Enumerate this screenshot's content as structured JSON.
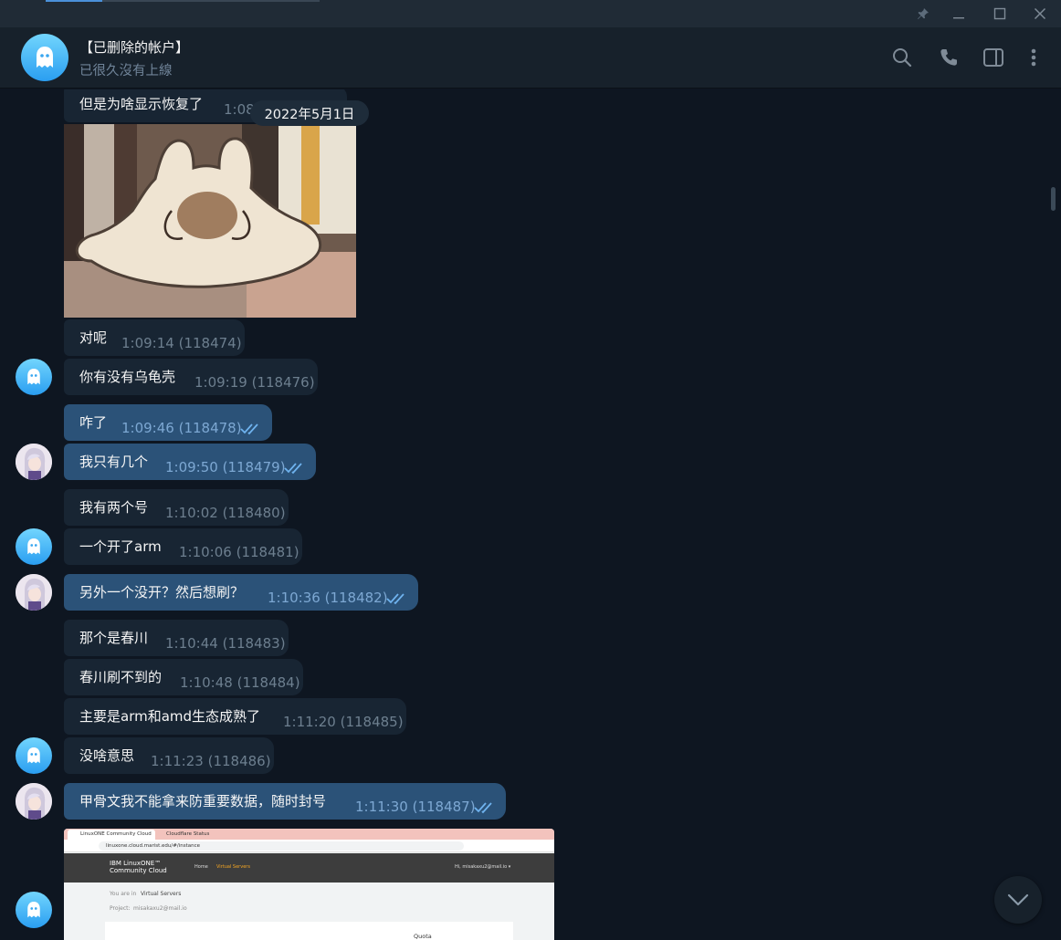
{
  "window": {
    "pin_icon": "pin-icon",
    "minimize_icon": "minimize-icon",
    "maximize_icon": "maximize-icon",
    "close_icon": "close-icon"
  },
  "header": {
    "title": "【已删除的帐户】",
    "status": "已很久沒有上線",
    "icons": [
      "search-icon",
      "phone-icon",
      "sidebar-toggle-icon",
      "more-vertical-icon"
    ]
  },
  "date_separator": "2022年5月1日",
  "messages": [
    {
      "text": "但是为啥显示恢复了",
      "meta": "1:08",
      "outgoing": false
    },
    {
      "text": "对呢",
      "meta": "1:09:14 (118474)",
      "outgoing": false
    },
    {
      "text": "你有没有乌龟壳",
      "meta": "1:09:19 (118476)",
      "outgoing": false
    },
    {
      "text": "咋了",
      "meta": "1:09:46 (118478)",
      "outgoing": true
    },
    {
      "text": "我只有几个",
      "meta": "1:09:50 (118479)",
      "outgoing": true
    },
    {
      "text": "我有两个号",
      "meta": "1:10:02 (118480)",
      "outgoing": false
    },
    {
      "text": "一个开了arm",
      "meta": "1:10:06 (118481)",
      "outgoing": false
    },
    {
      "text": "另外一个没开？然后想刷？",
      "meta": "1:10:36 (118482)",
      "outgoing": true
    },
    {
      "text": "那个是春川",
      "meta": "1:10:44 (118483)",
      "outgoing": false
    },
    {
      "text": "春川刷不到的",
      "meta": "1:10:48 (118484)",
      "outgoing": false
    },
    {
      "text": "主要是arm和amd生态成熟了",
      "meta": "1:11:20 (118485)",
      "outgoing": false
    },
    {
      "text": "没啥意思",
      "meta": "1:11:23 (118486)",
      "outgoing": false
    },
    {
      "text": "甲骨文我不能拿来防重要数据，随时封号",
      "meta": "1:11:30 (118487)",
      "outgoing": true
    }
  ],
  "screenshot_preview": {
    "tab1": "LinuxONE Community Cloud",
    "tab2": "Cloudflare Status",
    "url": "linuxone.cloud.marist.edu/#/instance",
    "logo_line1": "IBM LinuxONE™",
    "logo_line2": "Community Cloud",
    "nav_home": "Home",
    "nav_vs": "Virtual Servers",
    "user": "Hi, misakaxu2@mail.io ▾",
    "you_are_in": "You are in",
    "section": "Virtual Servers",
    "project_label": "Project:",
    "project_value": "misakaxu2@mail.io",
    "quota": "Quota"
  },
  "scroll_down_icon": "chevron-down-icon"
}
